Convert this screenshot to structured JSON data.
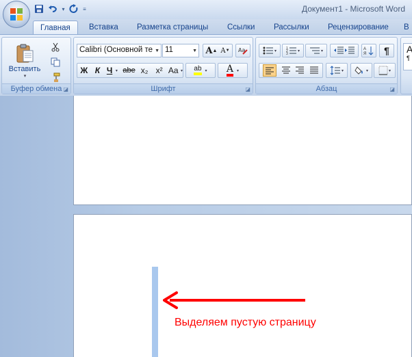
{
  "window": {
    "title": "Документ1 - Microsoft Word"
  },
  "tabs": [
    {
      "label": "Главная",
      "active": true
    },
    {
      "label": "Вставка"
    },
    {
      "label": "Разметка страницы"
    },
    {
      "label": "Ссылки"
    },
    {
      "label": "Рассылки"
    },
    {
      "label": "Рецензирование"
    },
    {
      "label": "В"
    }
  ],
  "clipboard": {
    "group_label": "Буфер обмена",
    "paste_label": "Вставить"
  },
  "font": {
    "group_label": "Шрифт",
    "font_name": "Calibri (Основной те",
    "font_size": "11",
    "bold": "Ж",
    "italic": "К",
    "underline": "Ч",
    "strike": "abe",
    "subscript": "x₂",
    "superscript": "x²",
    "change_case": "Aa",
    "grow": "A",
    "shrink": "A",
    "highlight": "ab",
    "font_color": "A",
    "highlight_color": "#ffff00",
    "font_color_value": "#ff0000"
  },
  "paragraph": {
    "group_label": "Абзац",
    "pilcrow": "¶"
  },
  "styles": {
    "preview": "А",
    "preview2": "¶"
  },
  "annotation": {
    "text": "Выделяем пустую страницу",
    "color": "#ff0000"
  }
}
